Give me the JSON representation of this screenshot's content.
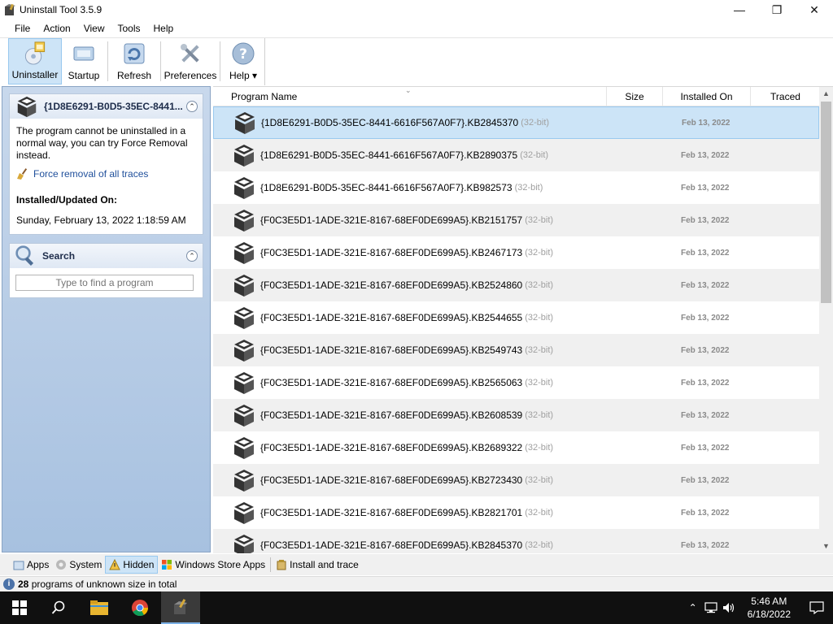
{
  "window": {
    "title": "Uninstall Tool 3.5.9",
    "controls": {
      "minimize": "—",
      "maximize": "❐",
      "close": "✕"
    }
  },
  "menu": [
    "File",
    "Action",
    "View",
    "Tools",
    "Help"
  ],
  "toolbar": {
    "buttons": [
      {
        "label": "Uninstaller",
        "icon": "uninstaller-icon",
        "active": true
      },
      {
        "label": "Startup",
        "icon": "startup-icon",
        "active": false
      },
      {
        "label": "Refresh",
        "icon": "refresh-icon",
        "active": false
      },
      {
        "label": "Preferences",
        "icon": "preferences-icon",
        "active": false
      },
      {
        "label": "Help ▾",
        "icon": "help-icon",
        "active": false
      }
    ]
  },
  "details": {
    "title": "{1D8E6291-B0D5-35EC-8441...",
    "message": "The program cannot be uninstalled in a normal way, you can try Force Removal instead.",
    "force_link": "Force removal of all traces",
    "installed_label": "Installed/Updated On:",
    "installed_value": "Sunday, February 13, 2022 1:18:59 AM",
    "collapse": "⌃"
  },
  "search": {
    "title": "Search",
    "placeholder": "Type to find a program",
    "collapse": "⌃"
  },
  "columns": {
    "name": "Program Name",
    "size": "Size",
    "installed": "Installed On",
    "traced": "Traced",
    "sort_caret": "⌄"
  },
  "programs": [
    {
      "name": "{1D8E6291-B0D5-35EC-8441-6616F567A0F7}.KB2845370",
      "bit": "(32-bit)",
      "date": "Feb 13, 2022",
      "selected": true
    },
    {
      "name": "{1D8E6291-B0D5-35EC-8441-6616F567A0F7}.KB2890375",
      "bit": "(32-bit)",
      "date": "Feb 13, 2022"
    },
    {
      "name": "{1D8E6291-B0D5-35EC-8441-6616F567A0F7}.KB982573",
      "bit": "(32-bit)",
      "date": "Feb 13, 2022"
    },
    {
      "name": "{F0C3E5D1-1ADE-321E-8167-68EF0DE699A5}.KB2151757",
      "bit": "(32-bit)",
      "date": "Feb 13, 2022"
    },
    {
      "name": "{F0C3E5D1-1ADE-321E-8167-68EF0DE699A5}.KB2467173",
      "bit": "(32-bit)",
      "date": "Feb 13, 2022"
    },
    {
      "name": "{F0C3E5D1-1ADE-321E-8167-68EF0DE699A5}.KB2524860",
      "bit": "(32-bit)",
      "date": "Feb 13, 2022"
    },
    {
      "name": "{F0C3E5D1-1ADE-321E-8167-68EF0DE699A5}.KB2544655",
      "bit": "(32-bit)",
      "date": "Feb 13, 2022"
    },
    {
      "name": "{F0C3E5D1-1ADE-321E-8167-68EF0DE699A5}.KB2549743",
      "bit": "(32-bit)",
      "date": "Feb 13, 2022"
    },
    {
      "name": "{F0C3E5D1-1ADE-321E-8167-68EF0DE699A5}.KB2565063",
      "bit": "(32-bit)",
      "date": "Feb 13, 2022"
    },
    {
      "name": "{F0C3E5D1-1ADE-321E-8167-68EF0DE699A5}.KB2608539",
      "bit": "(32-bit)",
      "date": "Feb 13, 2022"
    },
    {
      "name": "{F0C3E5D1-1ADE-321E-8167-68EF0DE699A5}.KB2689322",
      "bit": "(32-bit)",
      "date": "Feb 13, 2022"
    },
    {
      "name": "{F0C3E5D1-1ADE-321E-8167-68EF0DE699A5}.KB2723430",
      "bit": "(32-bit)",
      "date": "Feb 13, 2022"
    },
    {
      "name": "{F0C3E5D1-1ADE-321E-8167-68EF0DE699A5}.KB2821701",
      "bit": "(32-bit)",
      "date": "Feb 13, 2022"
    },
    {
      "name": "{F0C3E5D1-1ADE-321E-8167-68EF0DE699A5}.KB2845370",
      "bit": "(32-bit)",
      "date": "Feb 13, 2022"
    }
  ],
  "tabs": [
    {
      "label": "Apps",
      "icon": "apps-icon",
      "active": false
    },
    {
      "label": "System",
      "icon": "system-gear-icon",
      "active": false
    },
    {
      "label": "Hidden",
      "icon": "hidden-warning-icon",
      "active": true
    },
    {
      "label": "Windows Store Apps",
      "icon": "windows-store-icon",
      "active": false
    },
    {
      "label": "Install and trace",
      "icon": "install-trace-icon",
      "active": false
    }
  ],
  "status": {
    "count": "28",
    "text": "programs of unknown size in total",
    "info": "i"
  },
  "taskbar": {
    "time": "5:46 AM",
    "date": "6/18/2022",
    "tray_chevron": "⌃"
  },
  "colors": {
    "selection": "#cce4f7",
    "panel_gradient_top": "#c8d8ec",
    "panel_gradient_bottom": "#a7c1e0",
    "taskbar": "#101010"
  }
}
